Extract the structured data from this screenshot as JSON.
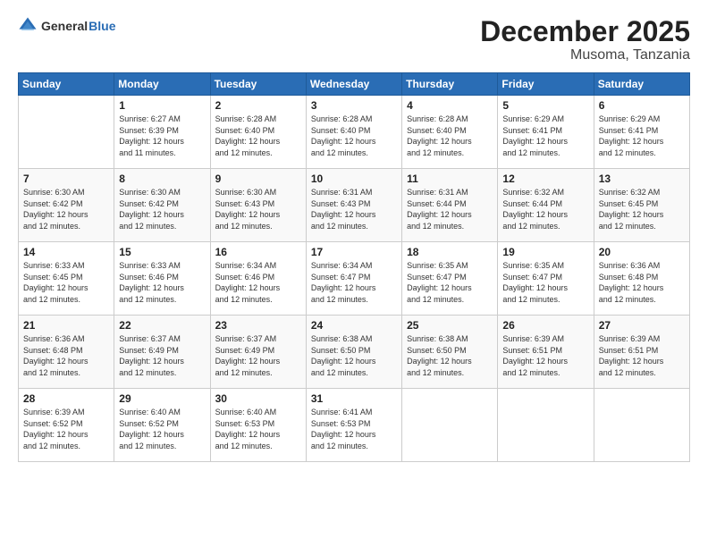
{
  "header": {
    "logo_general": "General",
    "logo_blue": "Blue",
    "month_title": "December 2025",
    "location": "Musoma, Tanzania"
  },
  "weekdays": [
    "Sunday",
    "Monday",
    "Tuesday",
    "Wednesday",
    "Thursday",
    "Friday",
    "Saturday"
  ],
  "weeks": [
    [
      {
        "day": "",
        "info": ""
      },
      {
        "day": "1",
        "info": "Sunrise: 6:27 AM\nSunset: 6:39 PM\nDaylight: 12 hours\nand 11 minutes."
      },
      {
        "day": "2",
        "info": "Sunrise: 6:28 AM\nSunset: 6:40 PM\nDaylight: 12 hours\nand 12 minutes."
      },
      {
        "day": "3",
        "info": "Sunrise: 6:28 AM\nSunset: 6:40 PM\nDaylight: 12 hours\nand 12 minutes."
      },
      {
        "day": "4",
        "info": "Sunrise: 6:28 AM\nSunset: 6:40 PM\nDaylight: 12 hours\nand 12 minutes."
      },
      {
        "day": "5",
        "info": "Sunrise: 6:29 AM\nSunset: 6:41 PM\nDaylight: 12 hours\nand 12 minutes."
      },
      {
        "day": "6",
        "info": "Sunrise: 6:29 AM\nSunset: 6:41 PM\nDaylight: 12 hours\nand 12 minutes."
      }
    ],
    [
      {
        "day": "7",
        "info": "Sunrise: 6:30 AM\nSunset: 6:42 PM\nDaylight: 12 hours\nand 12 minutes."
      },
      {
        "day": "8",
        "info": "Sunrise: 6:30 AM\nSunset: 6:42 PM\nDaylight: 12 hours\nand 12 minutes."
      },
      {
        "day": "9",
        "info": "Sunrise: 6:30 AM\nSunset: 6:43 PM\nDaylight: 12 hours\nand 12 minutes."
      },
      {
        "day": "10",
        "info": "Sunrise: 6:31 AM\nSunset: 6:43 PM\nDaylight: 12 hours\nand 12 minutes."
      },
      {
        "day": "11",
        "info": "Sunrise: 6:31 AM\nSunset: 6:44 PM\nDaylight: 12 hours\nand 12 minutes."
      },
      {
        "day": "12",
        "info": "Sunrise: 6:32 AM\nSunset: 6:44 PM\nDaylight: 12 hours\nand 12 minutes."
      },
      {
        "day": "13",
        "info": "Sunrise: 6:32 AM\nSunset: 6:45 PM\nDaylight: 12 hours\nand 12 minutes."
      }
    ],
    [
      {
        "day": "14",
        "info": "Sunrise: 6:33 AM\nSunset: 6:45 PM\nDaylight: 12 hours\nand 12 minutes."
      },
      {
        "day": "15",
        "info": "Sunrise: 6:33 AM\nSunset: 6:46 PM\nDaylight: 12 hours\nand 12 minutes."
      },
      {
        "day": "16",
        "info": "Sunrise: 6:34 AM\nSunset: 6:46 PM\nDaylight: 12 hours\nand 12 minutes."
      },
      {
        "day": "17",
        "info": "Sunrise: 6:34 AM\nSunset: 6:47 PM\nDaylight: 12 hours\nand 12 minutes."
      },
      {
        "day": "18",
        "info": "Sunrise: 6:35 AM\nSunset: 6:47 PM\nDaylight: 12 hours\nand 12 minutes."
      },
      {
        "day": "19",
        "info": "Sunrise: 6:35 AM\nSunset: 6:47 PM\nDaylight: 12 hours\nand 12 minutes."
      },
      {
        "day": "20",
        "info": "Sunrise: 6:36 AM\nSunset: 6:48 PM\nDaylight: 12 hours\nand 12 minutes."
      }
    ],
    [
      {
        "day": "21",
        "info": "Sunrise: 6:36 AM\nSunset: 6:48 PM\nDaylight: 12 hours\nand 12 minutes."
      },
      {
        "day": "22",
        "info": "Sunrise: 6:37 AM\nSunset: 6:49 PM\nDaylight: 12 hours\nand 12 minutes."
      },
      {
        "day": "23",
        "info": "Sunrise: 6:37 AM\nSunset: 6:49 PM\nDaylight: 12 hours\nand 12 minutes."
      },
      {
        "day": "24",
        "info": "Sunrise: 6:38 AM\nSunset: 6:50 PM\nDaylight: 12 hours\nand 12 minutes."
      },
      {
        "day": "25",
        "info": "Sunrise: 6:38 AM\nSunset: 6:50 PM\nDaylight: 12 hours\nand 12 minutes."
      },
      {
        "day": "26",
        "info": "Sunrise: 6:39 AM\nSunset: 6:51 PM\nDaylight: 12 hours\nand 12 minutes."
      },
      {
        "day": "27",
        "info": "Sunrise: 6:39 AM\nSunset: 6:51 PM\nDaylight: 12 hours\nand 12 minutes."
      }
    ],
    [
      {
        "day": "28",
        "info": "Sunrise: 6:39 AM\nSunset: 6:52 PM\nDaylight: 12 hours\nand 12 minutes."
      },
      {
        "day": "29",
        "info": "Sunrise: 6:40 AM\nSunset: 6:52 PM\nDaylight: 12 hours\nand 12 minutes."
      },
      {
        "day": "30",
        "info": "Sunrise: 6:40 AM\nSunset: 6:53 PM\nDaylight: 12 hours\nand 12 minutes."
      },
      {
        "day": "31",
        "info": "Sunrise: 6:41 AM\nSunset: 6:53 PM\nDaylight: 12 hours\nand 12 minutes."
      },
      {
        "day": "",
        "info": ""
      },
      {
        "day": "",
        "info": ""
      },
      {
        "day": "",
        "info": ""
      }
    ]
  ]
}
